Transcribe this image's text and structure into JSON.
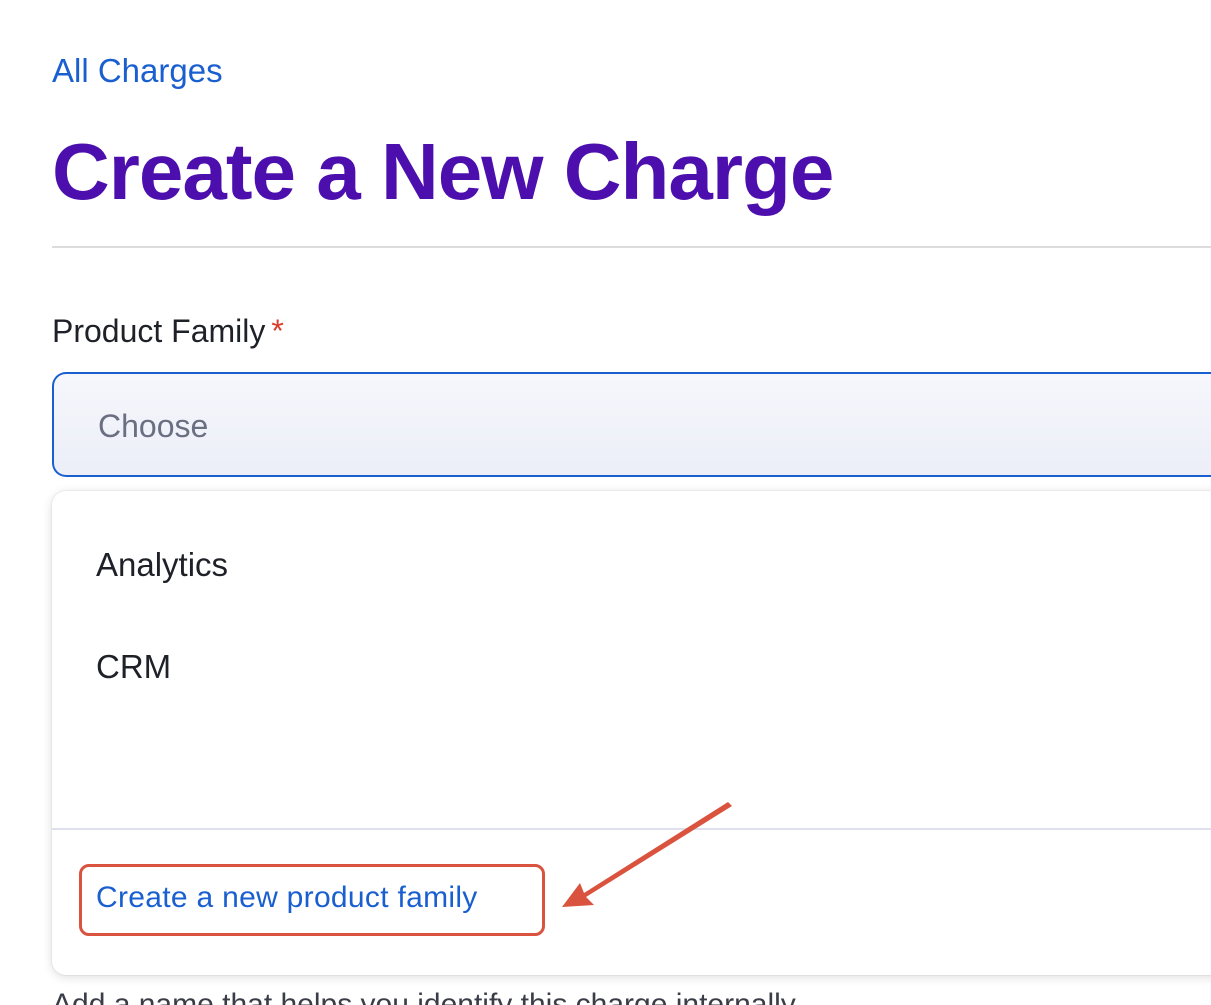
{
  "breadcrumb": {
    "label": "All Charges"
  },
  "page": {
    "title": "Create a New Charge"
  },
  "form": {
    "product_family": {
      "label": "Product Family",
      "required_marker": "*",
      "placeholder": "Choose",
      "options": [
        "Analytics",
        "CRM"
      ],
      "create_link": "Create a new product family"
    },
    "helper_text": "Add a name that helps you identify this charge internally."
  },
  "colors": {
    "accent": "#1a5fd0",
    "title": "#4c0fae",
    "required": "#d93e2b",
    "annotation": "#d9533e"
  }
}
